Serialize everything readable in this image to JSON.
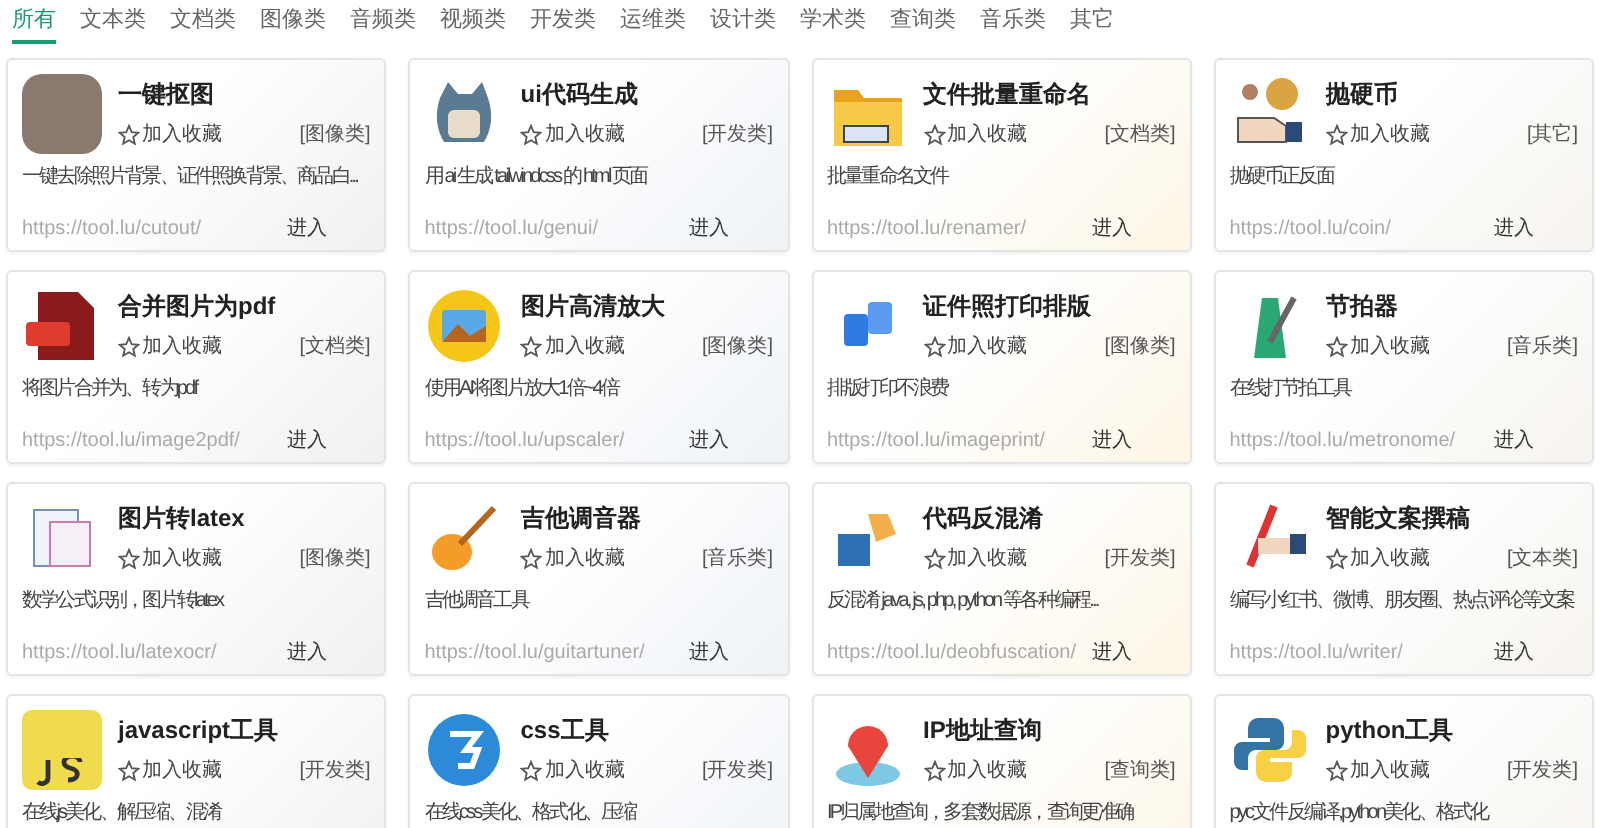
{
  "tabs": [
    {
      "label": "所有",
      "selected": true
    },
    {
      "label": "文本类",
      "selected": false
    },
    {
      "label": "文档类",
      "selected": false
    },
    {
      "label": "图像类",
      "selected": false
    },
    {
      "label": "音频类",
      "selected": false
    },
    {
      "label": "视频类",
      "selected": false
    },
    {
      "label": "开发类",
      "selected": false
    },
    {
      "label": "运维类",
      "selected": false
    },
    {
      "label": "设计类",
      "selected": false
    },
    {
      "label": "学术类",
      "selected": false
    },
    {
      "label": "查询类",
      "selected": false
    },
    {
      "label": "音乐类",
      "selected": false
    },
    {
      "label": "其它",
      "selected": false
    }
  ],
  "cards": [
    {
      "title": "一键抠图",
      "favorite": "加入收藏",
      "category": "[图像类]",
      "description": "一键去除照片背景、证件照换背景、商品白...",
      "url": "https://tool.lu/cutout/",
      "enter": "进入"
    },
    {
      "title": "ui代码生成",
      "favorite": "加入收藏",
      "category": "[开发类]",
      "description": "用 ai 生成 tailwindcss 的 html 页面",
      "url": "https://tool.lu/genui/",
      "enter": "进入"
    },
    {
      "title": "文件批量重命名",
      "favorite": "加入收藏",
      "category": "[文档类]",
      "description": "批量重命名文件",
      "url": "https://tool.lu/renamer/",
      "enter": "进入"
    },
    {
      "title": "抛硬币",
      "favorite": "加入收藏",
      "category": "[其它]",
      "description": "抛硬币正反面",
      "url": "https://tool.lu/coin/",
      "enter": "进入"
    },
    {
      "title": "合并图片为pdf",
      "favorite": "加入收藏",
      "category": "[文档类]",
      "description": "将图片合并为、转为pdf",
      "url": "https://tool.lu/image2pdf/",
      "enter": "进入"
    },
    {
      "title": "图片高清放大",
      "favorite": "加入收藏",
      "category": "[图像类]",
      "description": "使用AI将图片放大1倍~4倍",
      "url": "https://tool.lu/upscaler/",
      "enter": "进入"
    },
    {
      "title": "证件照打印排版",
      "favorite": "加入收藏",
      "category": "[图像类]",
      "description": "排版打印不浪费",
      "url": "https://tool.lu/imageprint/",
      "enter": "进入"
    },
    {
      "title": "节拍器",
      "favorite": "加入收藏",
      "category": "[音乐类]",
      "description": "在线打节拍工具",
      "url": "https://tool.lu/metronome/",
      "enter": "进入"
    },
    {
      "title": "图片转latex",
      "favorite": "加入收藏",
      "category": "[图像类]",
      "description": "数学公式识别，图片转latex",
      "url": "https://tool.lu/latexocr/",
      "enter": "进入"
    },
    {
      "title": "吉他调音器",
      "favorite": "加入收藏",
      "category": "[音乐类]",
      "description": "吉他调音工具",
      "url": "https://tool.lu/guitartuner/",
      "enter": "进入"
    },
    {
      "title": "代码反混淆",
      "favorite": "加入收藏",
      "category": "[开发类]",
      "description": "反混淆 java, js, php, python 等各种编程...",
      "url": "https://tool.lu/deobfuscation/",
      "enter": "进入"
    },
    {
      "title": "智能文案撰稿",
      "favorite": "加入收藏",
      "category": "[文本类]",
      "description": "编写小红书、微博、朋友圈、热点评论等文案",
      "url": "https://tool.lu/writer/",
      "enter": "进入"
    },
    {
      "title": "javascript工具",
      "favorite": "加入收藏",
      "category": "[开发类]",
      "description": "在线js美化、解压缩、混淆"
    },
    {
      "title": "css工具",
      "favorite": "加入收藏",
      "category": "[开发类]",
      "description": "在线css美化、格式化、压缩"
    },
    {
      "title": "IP地址查询",
      "favorite": "加入收藏",
      "category": "[查询类]",
      "description": "IP归属地查询，多套数据源，查询更准确"
    },
    {
      "title": "python工具",
      "favorite": "加入收藏",
      "category": "[开发类]",
      "description": "pyc文件反编译,python美化、格式化"
    }
  ]
}
